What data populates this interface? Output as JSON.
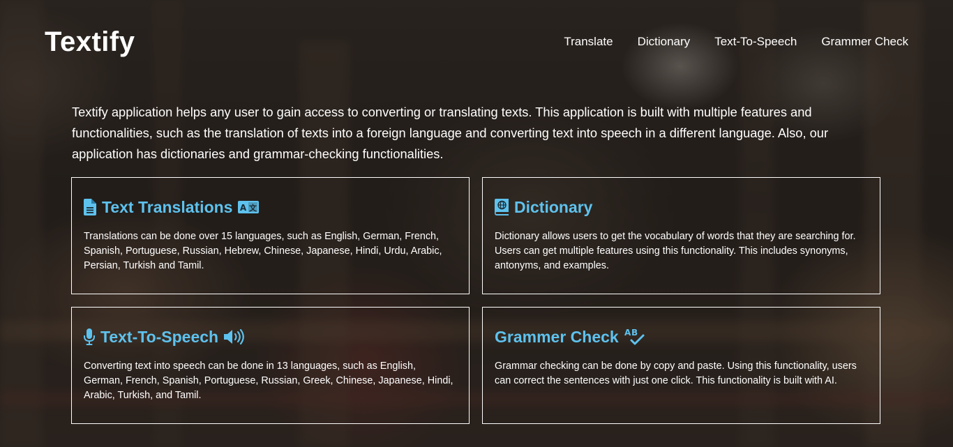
{
  "header": {
    "logo": "Textify",
    "nav": [
      {
        "label": "Translate"
      },
      {
        "label": "Dictionary"
      },
      {
        "label": "Text-To-Speech"
      },
      {
        "label": "Grammer Check"
      }
    ]
  },
  "intro": "Textify application helps any user to gain access to converting or translating texts. This application is built with multiple features and functionalities, such as the translation of texts into a foreign language and converting text into speech in a different language. Also, our application has dictionaries and grammar-checking functionalities.",
  "cards": [
    {
      "title": "Text Translations",
      "icon": "document-icon",
      "trailing_icon": "translate-icon",
      "text": "Translations can be done over 15 languages, such as English, German, French, Spanish, Portuguese, Russian, Hebrew, Chinese, Japanese, Hindi, Urdu, Arabic, Persian, Turkish and Tamil."
    },
    {
      "title": "Dictionary",
      "icon": "book-globe-icon",
      "text": "Dictionary allows users to get the vocabulary of words that they are searching for. Users can get multiple features using this functionality. This includes synonyms, antonyms, and examples."
    },
    {
      "title": "Text-To-Speech",
      "icon": "microphone-icon",
      "trailing_icon": "speaker-icon",
      "text": "Converting text into speech can be done in 13 languages, such as English, German, French, Spanish, Portuguese, Russian, Greek, Chinese, Japanese, Hindi, Arabic, Turkish, and Tamil."
    },
    {
      "title": "Grammer Check",
      "trailing_icon": "spellcheck-icon",
      "text": "Grammar checking can be done by copy and paste. Using this functionality, users can correct the sentences with just one click. This functionality is built with AI."
    }
  ],
  "colors": {
    "accent": "#5ec2ee",
    "text": "#ffffff",
    "border": "#ffffff"
  }
}
